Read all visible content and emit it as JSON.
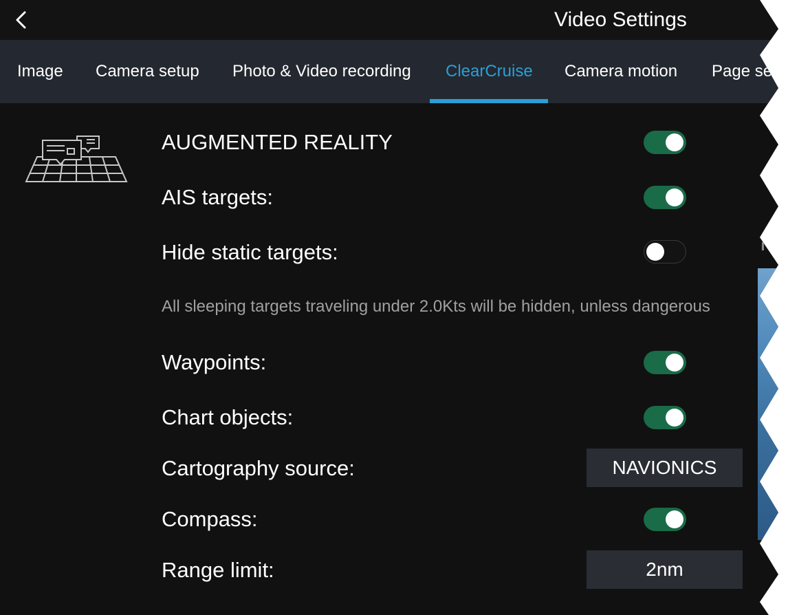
{
  "header": {
    "title": "Video Settings",
    "back_icon": "chevron-left-icon"
  },
  "tabs": [
    {
      "label": "Image",
      "active": false
    },
    {
      "label": "Camera setup",
      "active": false
    },
    {
      "label": "Photo & Video recording",
      "active": false
    },
    {
      "label": "ClearCruise",
      "active": true
    },
    {
      "label": "Camera motion",
      "active": false
    },
    {
      "label": "Page se",
      "active": false
    }
  ],
  "section": {
    "icon": "augmented-reality-icon",
    "heading": "AUGMENTED REALITY",
    "heading_enabled": true
  },
  "settings": {
    "ais_targets": {
      "label": "AIS targets:",
      "enabled": true
    },
    "hide_static_targets": {
      "label": "Hide static targets:",
      "enabled": false
    },
    "hide_static_note": "All sleeping targets traveling under 2.0Kts will be hidden, unless dangerous",
    "waypoints": {
      "label": "Waypoints:",
      "enabled": true
    },
    "chart_objects": {
      "label": "Chart objects:",
      "enabled": true
    },
    "cartography_source": {
      "label": "Cartography source:",
      "value": "NAVIONICS"
    },
    "compass": {
      "label": "Compass:",
      "enabled": true
    },
    "range_limit": {
      "label": "Range limit:",
      "value": "2nm"
    }
  },
  "colors": {
    "background": "#111111",
    "tabbar": "#242830",
    "accent": "#2a9fd6",
    "toggle_on": "#1a6b48",
    "select_bg": "#2a2d33"
  }
}
